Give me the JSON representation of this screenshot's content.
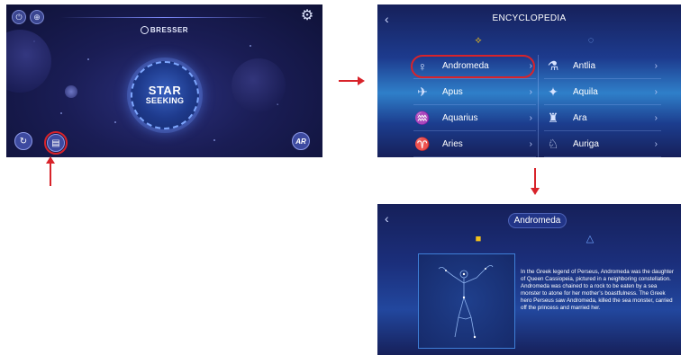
{
  "home": {
    "brand": "BRESSER",
    "star_line1": "STAR",
    "star_line2": "SEEKING",
    "icons": {
      "top_left_1": "power-icon",
      "top_left_2": "globe-icon",
      "top_right": "gear-icon",
      "bottom_left": "reload-icon",
      "bottom_left_2": "encyclopedia-icon",
      "bottom_right": "ar-icon"
    },
    "ar_label": "AR"
  },
  "encyclopedia": {
    "title": "ENCYCLOPEDIA",
    "tabs": [
      "constellation-icon",
      "planet-icon"
    ],
    "rows": [
      {
        "left": "Andromeda",
        "right": "Antlia"
      },
      {
        "left": "Apus",
        "right": "Aquila"
      },
      {
        "left": "Aquarius",
        "right": "Ara"
      },
      {
        "left": "Aries",
        "right": "Auriga"
      }
    ]
  },
  "detail": {
    "title": "Andromeda",
    "description": "In the Greek legend of Perseus, Andromeda was the daughter of Queen Cassiopeia, pictured in a neighboring constellation. Andromeda was chained to a rock to be eaten by a sea monster to atone for her mother’s boastfulness. The Greek hero Perseus saw Andromeda, killed the sea monster, carried off the princess and married her."
  },
  "colors": {
    "highlight": "#d8232a",
    "home_bg": "#1a1d55",
    "accent_blue": "#2f7fc9",
    "cube_yellow": "#f4c21b"
  }
}
